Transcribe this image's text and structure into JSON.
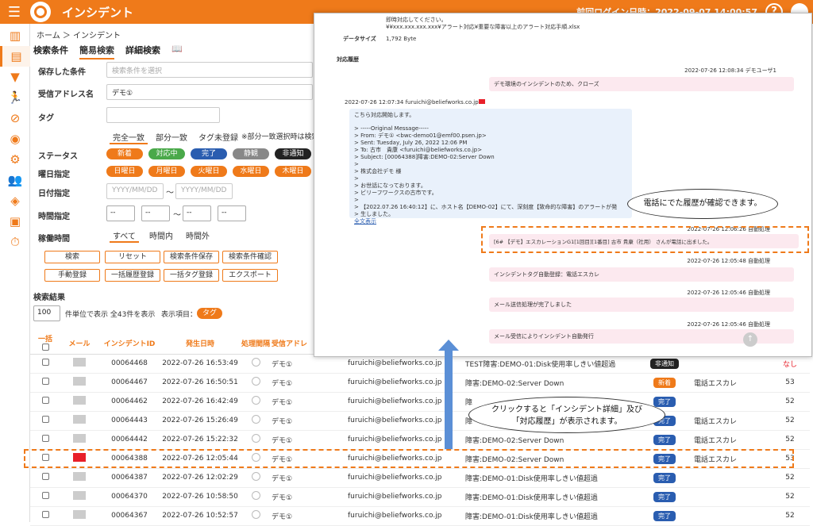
{
  "header": {
    "title": "インシデント",
    "last_login": "前回ログイン日時：2022-09-07 14:00:57",
    "help": "?"
  },
  "breadcrumb": "ホーム ＞ インシデント",
  "tabs": [
    "検索条件",
    "簡易検索",
    "詳細検索"
  ],
  "search": {
    "saved_label": "保存した条件",
    "saved_placeholder": "検索条件を選択",
    "address_label": "受信アドレス名",
    "address_value": "デモ①",
    "tag_label": "タグ",
    "match_opts": [
      "完全一致",
      "部分一致",
      "タグ未登録"
    ],
    "match_note": "※部分一致選択時は検索",
    "status_label": "ステータス",
    "status": [
      "新着",
      "対応中",
      "完了",
      "静観",
      "非通知"
    ],
    "day_label": "曜日指定",
    "days": [
      "日曜日",
      "月曜日",
      "火曜日",
      "水曜日",
      "木曜日"
    ],
    "date_label": "日付指定",
    "date_ph": "YYYY/MM/DD",
    "tilde": "～",
    "time_label": "時間指定",
    "time_sel": "--",
    "work_label": "稼働時間",
    "work_opts": [
      "すべて",
      "時間内",
      "時間外"
    ]
  },
  "buttons": [
    "検索",
    "リセット",
    "検索条件保存",
    "検索条件確認",
    "手動登録",
    "一括履歴登録",
    "一括タグ登録",
    "エクスポート"
  ],
  "results": {
    "title": "検索結果",
    "per_page": "100",
    "per_text": "件単位で表示 全43件を表示",
    "disp_label": "表示項目：",
    "disp_tag": "タグ"
  },
  "table": {
    "headers": [
      "一括",
      "メール",
      "インシデントID",
      "発生日時",
      "処理間隔",
      "受信アドレ"
    ],
    "rows": [
      {
        "id": "00064468",
        "time": "2022-07-26 16:53:49",
        "addr": "デモ①",
        "from": "furuichi@beliefworks.co.jp",
        "subject": "TEST障害:DEMO-01:Disk使用率しきい値超過",
        "status": "非通知",
        "tag": "",
        "num": "なし",
        "red": false
      },
      {
        "id": "00064467",
        "time": "2022-07-26 16:50:51",
        "addr": "デモ①",
        "from": "furuichi@beliefworks.co.jp",
        "subject": "障害:DEMO-02:Server Down",
        "status": "新着",
        "tag": "電話エスカレ",
        "num": "53",
        "red": false
      },
      {
        "id": "00064462",
        "time": "2022-07-26 16:42:49",
        "addr": "デモ①",
        "from": "furuichi@beliefworks.co.jp",
        "subject": "障",
        "status": "完了",
        "tag": "",
        "num": "52",
        "red": false
      },
      {
        "id": "00064443",
        "time": "2022-07-26 15:26:49",
        "addr": "デモ①",
        "from": "furuichi@beliefworks.co.jp",
        "subject": "障",
        "status": "完了",
        "tag": "電話エスカレ",
        "num": "52",
        "red": false
      },
      {
        "id": "00064442",
        "time": "2022-07-26 15:22:32",
        "addr": "デモ①",
        "from": "furuichi@beliefworks.co.jp",
        "subject": "障害:DEMO-02:Server Down",
        "status": "完了",
        "tag": "電話エスカレ",
        "num": "52",
        "red": false
      },
      {
        "id": "00064388",
        "time": "2022-07-26 12:05:44",
        "addr": "デモ①",
        "from": "furuichi@beliefworks.co.jp",
        "subject": "障害:DEMO-02:Server Down",
        "status": "完了",
        "tag": "電話エスカレ",
        "num": "53",
        "red": true
      },
      {
        "id": "00064387",
        "time": "2022-07-26 12:02:29",
        "addr": "デモ①",
        "from": "furuichi@beliefworks.co.jp",
        "subject": "障害:DEMO-01:Disk使用率しきい値超過",
        "status": "完了",
        "tag": "",
        "num": "52",
        "red": false
      },
      {
        "id": "00064370",
        "time": "2022-07-26 10:58:50",
        "addr": "デモ①",
        "from": "furuichi@beliefworks.co.jp",
        "subject": "障害:DEMO-01:Disk使用率しきい値超過",
        "status": "完了",
        "tag": "",
        "num": "52",
        "red": false
      },
      {
        "id": "00064367",
        "time": "2022-07-26 10:52:57",
        "addr": "デモ①",
        "from": "furuichi@beliefworks.co.jp",
        "subject": "障害:DEMO-01:Disk使用率しきい値超過",
        "status": "完了",
        "tag": "",
        "num": "52",
        "red": false
      }
    ]
  },
  "panel": {
    "top1": "即時対応してください。",
    "top2": "¥¥xxx.xxx.xxx.xxx¥アラート対応¥重要な障害以上のアラート対応手順.xlsx",
    "size_label": "データサイズ",
    "size_value": "1,792 Byte",
    "history_label": "対応履歴",
    "h1_meta": "2022-07-26 12:08:34 デモユーザ1",
    "h1_text": "デモ環境のインシデントのため、クローズ",
    "mail_meta": "2022-07-26 12:07:34 furuichi@beliefworks.co.jp",
    "mail_lines": [
      "こちら対応開始します。",
      "",
      "> -----Original Message-----",
      "> From: デモ① <bwc-demo01@emf00.psen.jp>",
      "> Sent: Tuesday, July 26, 2022 12:06 PM",
      "> To: 古市　貴康 <furuichi@beliefworks.co.jp>",
      "> Subject: [00064388]障害:DEMO-02:Server Down",
      ">",
      "> 株式会社デモ 様",
      ">",
      "> お世話になっております。",
      "> ビリーフワークスの古市です。",
      ">",
      "> 【2022.07.26 16:40:12】に、ホスト名【DEMO-02】にて、深刻度【致命的な障害】のアラートが発",
      "> 生しました。"
    ],
    "mail_more": "全文表示",
    "h2_meta": "2022-07-26 12:06:26 自動処理",
    "h2_text": "[6# 【デモ】エスカレーションG1[1回目][1番目] 古市 貴康（社用） さんが電話に出ました。",
    "h3_meta": "2022-07-26 12:05:48 自動処理",
    "h3_text": "インシデントタグ自動登録：電話エスカレ",
    "h4_meta": "2022-07-26 12:05:46 自動処理",
    "h4_text": "メール送信処理が完了しました",
    "h5_meta": "2022-07-26 12:05:46 自動処理",
    "h5_text": "メール受信によりインシデント自動発行"
  },
  "callouts": {
    "c1": "電話にでた履歴が確認できます。",
    "c2a": "クリックすると「インシデント詳細」及び",
    "c2b": "「対応履歴」が表示されます。"
  },
  "colors": {
    "accent": "#ef7a1a",
    "new": "#ef7a1a",
    "working": "#4aa94a",
    "done": "#2a5db0",
    "watch": "#888888",
    "noti": "#222222"
  }
}
